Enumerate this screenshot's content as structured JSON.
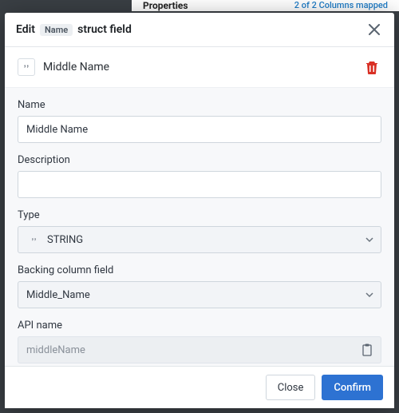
{
  "background": {
    "properties_heading": "Properties",
    "mapped_text": "2 of 2 Columns mapped"
  },
  "modal": {
    "title_prefix": "Edit",
    "title_tag": "Name",
    "title_suffix": "struct field",
    "field_name_display": "Middle Name",
    "form": {
      "name": {
        "label": "Name",
        "value": "Middle Name"
      },
      "description": {
        "label": "Description",
        "value": ""
      },
      "type": {
        "label": "Type",
        "value": "STRING"
      },
      "backing": {
        "label": "Backing column field",
        "value": "Middle_Name"
      },
      "api": {
        "label": "API name",
        "value": "middleName"
      }
    },
    "buttons": {
      "close": "Close",
      "confirm": "Confirm"
    }
  }
}
